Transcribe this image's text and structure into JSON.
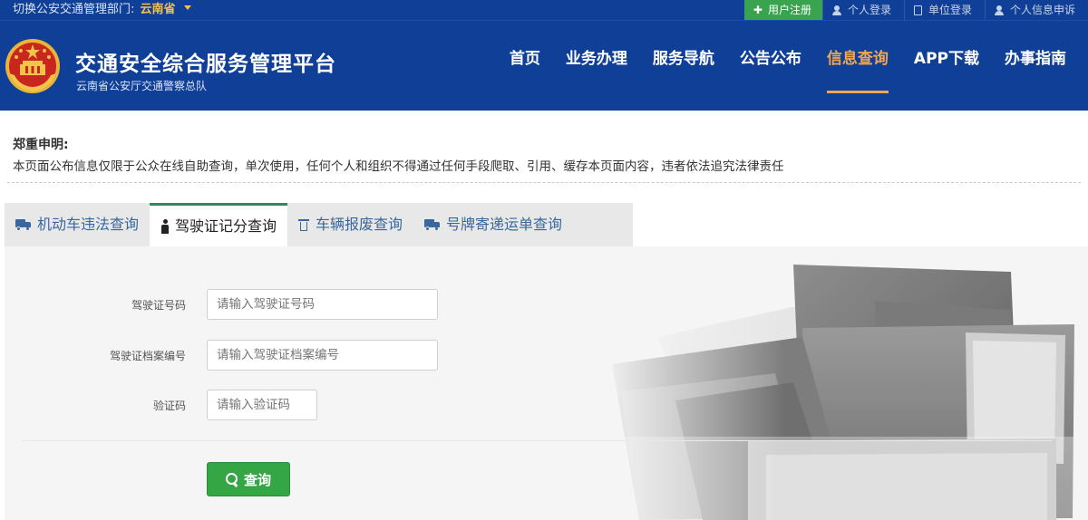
{
  "topbar": {
    "region_label": "切换公安交通管理部门:",
    "region_value": "云南省",
    "links": {
      "register": "用户注册",
      "personal_login": "个人登录",
      "unit_login": "单位登录",
      "personal_info": "个人信息申诉"
    }
  },
  "header": {
    "title": "交通安全综合服务管理平台",
    "subtitle": "云南省公安厅交通警察总队",
    "nav": {
      "home": "首页",
      "business": "业务办理",
      "guide": "服务导航",
      "notice": "公告公布",
      "query": "信息查询",
      "app": "APP下载",
      "howto": "办事指南"
    },
    "active_nav": "信息查询"
  },
  "notice": {
    "title": "郑重申明:",
    "text": "本页面公布信息仅限于公众在线自助查询，单次使用，任何个人和组织不得通过任何手段爬取、引用、缓存本页面内容，违者依法追究法律责任"
  },
  "tabs": {
    "vehicle_violation": "机动车违法查询",
    "license_points": "驾驶证记分查询",
    "vehicle_scrap": "车辆报废查询",
    "plate_mail": "号牌寄递运单查询",
    "active": "驾驶证记分查询"
  },
  "form": {
    "license_no_label": "驾驶证号码",
    "license_no_placeholder": "请输入驾驶证号码",
    "file_no_label": "驾驶证档案编号",
    "file_no_placeholder": "请输入驾驶证档案编号",
    "captcha_label": "验证码",
    "captcha_placeholder": "请输入验证码",
    "submit_label": "查询"
  },
  "colors": {
    "header_bg": "#0f3f96",
    "active_nav": "#f0a64e",
    "register_bg": "#3aa34d",
    "tab_text": "#38679f",
    "tab_active_border": "#2e8a57",
    "submit_bg": "#35a645"
  },
  "icons": {
    "emblem": "national-emblem-icon",
    "register": "plus-icon",
    "personal_login": "user-icon",
    "unit_login": "document-icon",
    "personal_info": "user-icon",
    "vehicle_violation": "truck-icon",
    "license_points": "person-icon",
    "vehicle_scrap": "trash-icon",
    "plate_mail": "truck-icon",
    "submit": "search-icon"
  }
}
